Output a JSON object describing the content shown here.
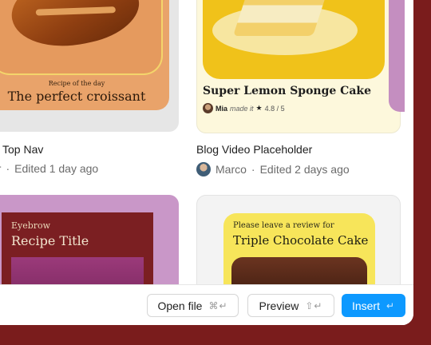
{
  "cards": [
    {
      "eyebrow": "Recipe of the day",
      "title": "The perfect croissant",
      "label": "Top Nav",
      "author": "Oscar",
      "edited": "Edited 1 day ago",
      "author_visible": "scar"
    },
    {
      "title": "Super Lemon Sponge Cake",
      "meta_name": "Mia",
      "meta_action": "made it",
      "meta_star": "★",
      "meta_rating": "4.8 / 5",
      "label": "Blog Video Placeholder",
      "author": "Marco",
      "edited": "Edited 2 days ago"
    },
    {
      "eyebrow": "Eyebrow",
      "title": "Recipe Title"
    },
    {
      "eyebrow": "Please leave a review for",
      "title": "Triple Chocolate Cake"
    }
  ],
  "separator": "·",
  "footer": {
    "open_file": {
      "label": "Open file",
      "shortcut": "⌘↵"
    },
    "preview": {
      "label": "Preview",
      "shortcut": "⇧↵"
    },
    "insert": {
      "label": "Insert",
      "shortcut": "↵"
    }
  },
  "colors": {
    "background": "#7a1c1c",
    "accent": "#0d99ff"
  }
}
